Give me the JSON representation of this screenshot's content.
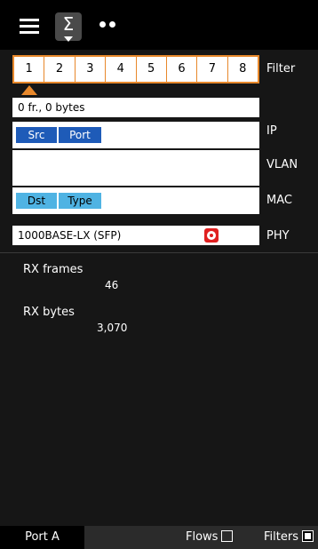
{
  "toolbar": {
    "menu_icon": "hamburger-icon",
    "sigma_symbol": "Σ",
    "dots_icon": "two-dots-icon"
  },
  "filters": {
    "label": "Filter",
    "cells": [
      "1",
      "2",
      "3",
      "4",
      "5",
      "6",
      "7",
      "8"
    ],
    "selected_index": 1
  },
  "frame_summary": "0 fr., 0 bytes",
  "ip": {
    "label": "IP",
    "tags": [
      "Src",
      "Port"
    ]
  },
  "vlan": {
    "label": "VLAN"
  },
  "mac": {
    "label": "MAC",
    "tags": [
      "Dst",
      "Type"
    ]
  },
  "phy": {
    "label": "PHY",
    "value": "1000BASE-LX (SFP)",
    "status_icon": "sfp-lifebuoy-icon"
  },
  "stats": {
    "rx_frames_label": "RX frames",
    "rx_frames_value": "46",
    "rx_bytes_label": "RX bytes",
    "rx_bytes_value": "3,070"
  },
  "bottom": {
    "port_tab": "Port A",
    "flows_label": "Flows",
    "flows_checked": false,
    "filters_label": "Filters",
    "filters_checked": true
  },
  "colors": {
    "accent_orange": "#e8882b",
    "tag_dark_blue": "#1e5bb8",
    "tag_light_blue": "#4fb3e3",
    "phy_icon_red": "#e02020"
  }
}
